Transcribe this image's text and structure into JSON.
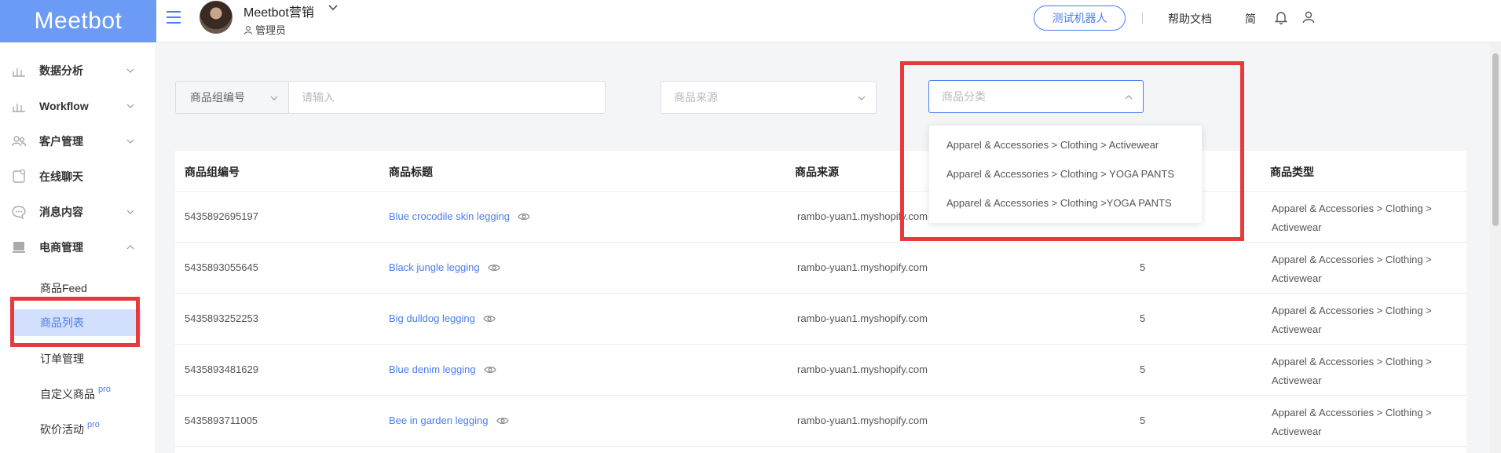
{
  "brand": {
    "logo_text": "Meetbot"
  },
  "header": {
    "account_name": "Meetbot营销",
    "role": "管理员",
    "test_bot_button": "测试机器人",
    "help_docs": "帮助文档",
    "language": "简"
  },
  "sidebar": {
    "groups": [
      {
        "label": "数据分析",
        "icon": "chart-icon"
      },
      {
        "label": "Workflow",
        "icon": "workflow-icon"
      },
      {
        "label": "客户管理",
        "icon": "users-icon"
      },
      {
        "label": "在线聊天",
        "icon": "chat-icon"
      },
      {
        "label": "消息内容",
        "icon": "message-icon"
      },
      {
        "label": "电商管理",
        "icon": "shop-icon"
      }
    ],
    "sub_items": [
      {
        "label": "商品Feed"
      },
      {
        "label": "商品列表",
        "active": true
      },
      {
        "label": "订单管理"
      },
      {
        "label": "自定义商品",
        "badge": "pro"
      },
      {
        "label": "砍价活动",
        "badge": "pro"
      }
    ]
  },
  "filters": {
    "group_id_label": "商品组编号",
    "input_placeholder": "请输入",
    "source_placeholder": "商品来源",
    "category_placeholder": "商品分类",
    "category_options": [
      "Apparel & Accessories > Clothing > Activewear",
      "Apparel & Accessories > Clothing > YOGA PANTS",
      "Apparel & Accessories > Clothing >YOGA PANTS"
    ]
  },
  "table": {
    "columns": [
      "商品组编号",
      "商品标题",
      "商品来源",
      "商品类型"
    ],
    "rows": [
      {
        "id": "5435892695197",
        "title": "Blue crocodile skin legging",
        "source": "rambo-yuan1.myshopify.com",
        "count": "",
        "type": "Apparel & Accessories > Clothing > Activewear"
      },
      {
        "id": "5435893055645",
        "title": "Black jungle legging",
        "source": "rambo-yuan1.myshopify.com",
        "count": "5",
        "type": "Apparel & Accessories > Clothing > Activewear"
      },
      {
        "id": "5435893252253",
        "title": "Big dulldog legging",
        "source": "rambo-yuan1.myshopify.com",
        "count": "5",
        "type": "Apparel & Accessories > Clothing > Activewear"
      },
      {
        "id": "5435893481629",
        "title": "Blue denim legging",
        "source": "rambo-yuan1.myshopify.com",
        "count": "5",
        "type": "Apparel & Accessories > Clothing > Activewear"
      },
      {
        "id": "5435893711005",
        "title": "Bee in garden legging",
        "source": "rambo-yuan1.myshopify.com",
        "count": "5",
        "type": "Apparel & Accessories > Clothing > Activewear"
      }
    ]
  },
  "colors": {
    "accent": "#4a7cf0",
    "logo_bg": "#6c9bf5",
    "highlight": "#e83a3a",
    "active_bg": "#d3e0fd"
  }
}
